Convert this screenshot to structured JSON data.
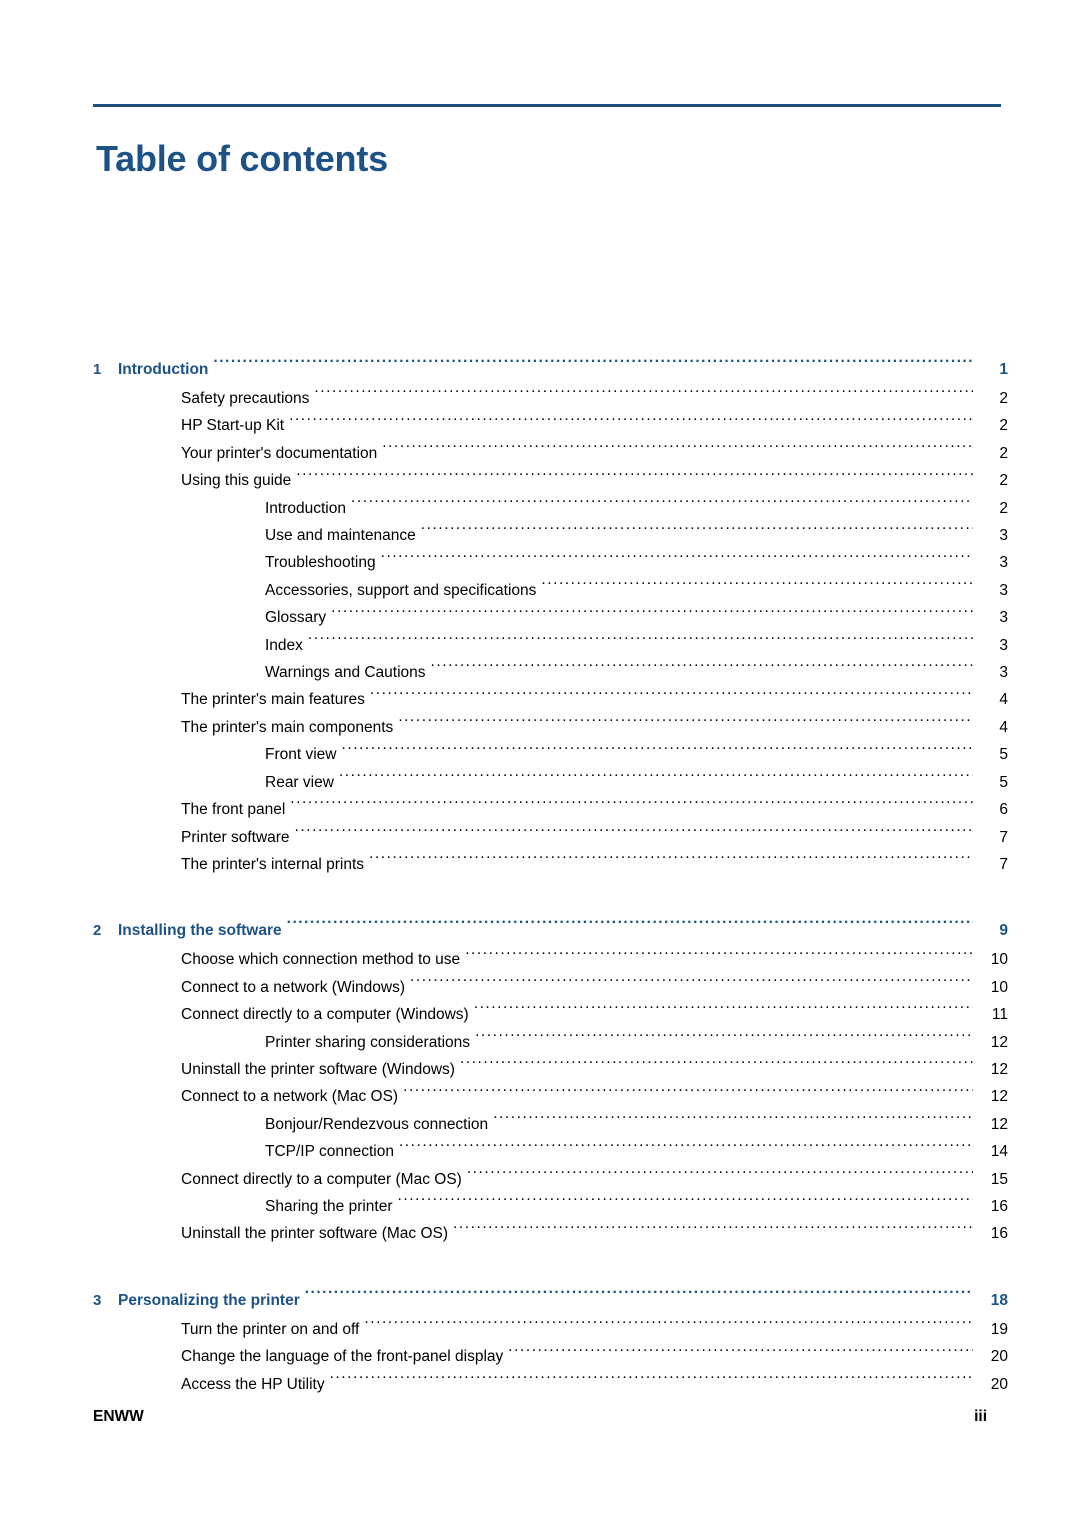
{
  "document": {
    "title": "Table of contents",
    "footer_left": "ENWW",
    "footer_right": "iii"
  },
  "toc": {
    "chapters": [
      {
        "number": "1",
        "label": "Introduction",
        "page": "1",
        "entries": [
          {
            "level": 1,
            "label": "Safety precautions",
            "page": "2"
          },
          {
            "level": 1,
            "label": "HP Start-up Kit",
            "page": "2"
          },
          {
            "level": 1,
            "label": "Your printer's documentation",
            "page": "2"
          },
          {
            "level": 1,
            "label": "Using this guide",
            "page": "2"
          },
          {
            "level": 2,
            "label": "Introduction",
            "page": "2"
          },
          {
            "level": 2,
            "label": "Use and maintenance",
            "page": "3"
          },
          {
            "level": 2,
            "label": "Troubleshooting",
            "page": "3"
          },
          {
            "level": 2,
            "label": "Accessories, support and specifications",
            "page": "3"
          },
          {
            "level": 2,
            "label": "Glossary",
            "page": "3"
          },
          {
            "level": 2,
            "label": "Index",
            "page": "3"
          },
          {
            "level": 2,
            "label": "Warnings and Cautions",
            "page": "3"
          },
          {
            "level": 1,
            "label": "The printer's main features",
            "page": "4"
          },
          {
            "level": 1,
            "label": "The printer's main components",
            "page": "4"
          },
          {
            "level": 2,
            "label": "Front view",
            "page": "5"
          },
          {
            "level": 2,
            "label": "Rear view",
            "page": "5"
          },
          {
            "level": 1,
            "label": "The front panel",
            "page": "6"
          },
          {
            "level": 1,
            "label": "Printer software",
            "page": "7"
          },
          {
            "level": 1,
            "label": "The printer's internal prints",
            "page": "7"
          }
        ]
      },
      {
        "number": "2",
        "label": "Installing the software",
        "page": "9",
        "entries": [
          {
            "level": 1,
            "label": "Choose which connection method to use",
            "page": "10"
          },
          {
            "level": 1,
            "label": "Connect to a network (Windows)",
            "page": "10"
          },
          {
            "level": 1,
            "label": "Connect directly to a computer (Windows)",
            "page": "11"
          },
          {
            "level": 2,
            "label": "Printer sharing considerations",
            "page": "12"
          },
          {
            "level": 1,
            "label": "Uninstall the printer software (Windows)",
            "page": "12"
          },
          {
            "level": 1,
            "label": "Connect to a network (Mac OS)",
            "page": "12"
          },
          {
            "level": 2,
            "label": "Bonjour/Rendezvous connection",
            "page": "12"
          },
          {
            "level": 2,
            "label": "TCP/IP connection",
            "page": "14"
          },
          {
            "level": 1,
            "label": "Connect directly to a computer (Mac OS)",
            "page": "15"
          },
          {
            "level": 2,
            "label": "Sharing the printer",
            "page": "16"
          },
          {
            "level": 1,
            "label": "Uninstall the printer software (Mac OS)",
            "page": "16"
          }
        ]
      },
      {
        "number": "3",
        "label": "Personalizing the printer",
        "page": "18",
        "entries": [
          {
            "level": 1,
            "label": "Turn the printer on and off",
            "page": "19"
          },
          {
            "level": 1,
            "label": "Change the language of the front-panel display",
            "page": "20"
          },
          {
            "level": 1,
            "label": "Access the HP Utility",
            "page": "20"
          }
        ]
      }
    ]
  }
}
